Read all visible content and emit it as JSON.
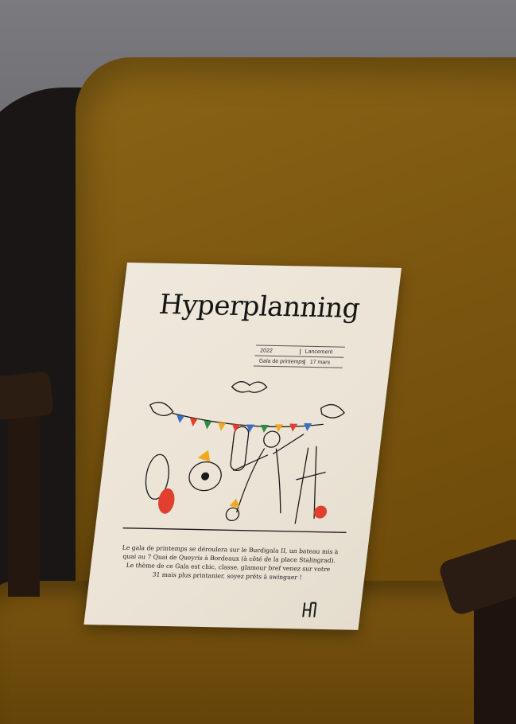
{
  "poster": {
    "title": "Hyperplanning",
    "table": {
      "row1": [
        "2022",
        "Lancement"
      ],
      "row2": [
        "Gala de printemps",
        "17 mars"
      ]
    },
    "body": [
      "Le gala de printemps se déroulera sur le Burdigala II, un bateau mis à",
      "quai au 7 Quai de Queyris à Bordeaux (à côté de la place Stalingrad).",
      "Le thème de ce Gala est chic, classe, glamour bref venez sur votre",
      "31 mais plus printanier, soyez prêts à swinguer !"
    ],
    "logo": "hyperplanning-logo-icon"
  },
  "colors": {
    "chair": "#7b560f",
    "paper": "#ece4d6",
    "wall": "#6f6e72",
    "accent_red": "#e1402e",
    "accent_orange": "#f0a81f",
    "accent_green": "#2f8a4a",
    "accent_blue": "#3c6fc2"
  }
}
